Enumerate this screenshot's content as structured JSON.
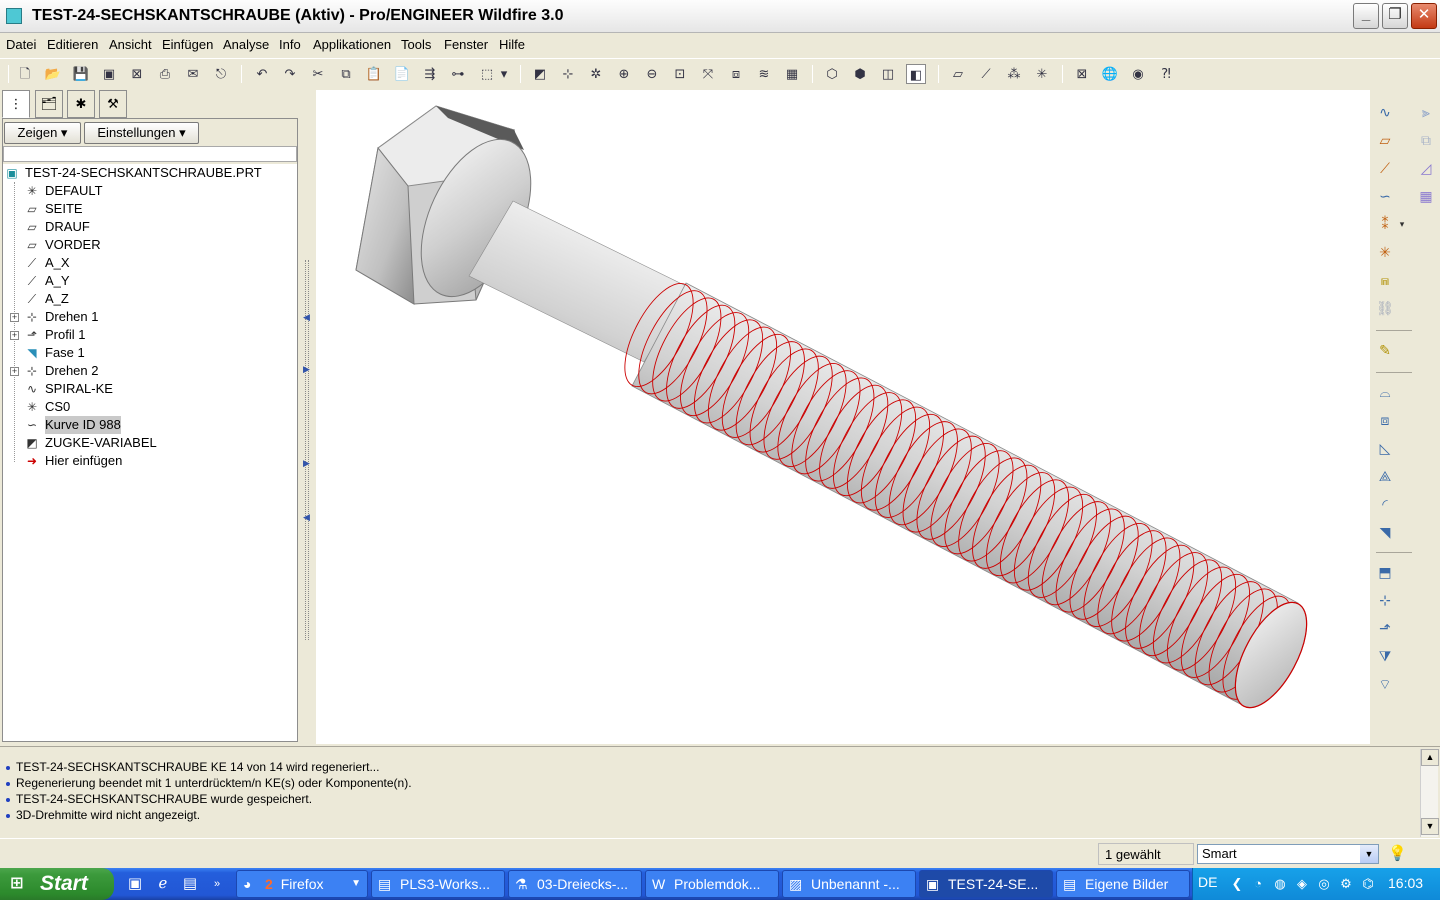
{
  "window": {
    "title": "TEST-24-SECHSKANTSCHRAUBE (Aktiv) - Pro/ENGINEER Wildfire 3.0"
  },
  "menu": [
    "Datei",
    "Editieren",
    "Ansicht",
    "Einfügen",
    "Analyse",
    "Info",
    "Applikationen",
    "Tools",
    "Fenster",
    "Hilfe"
  ],
  "nav": {
    "show_button": "Zeigen",
    "settings_button": "Einstellungen",
    "tree": [
      {
        "label": "TEST-24-SECHSKANTSCHRAUBE.PRT",
        "icon": "part-icon"
      },
      {
        "label": "DEFAULT",
        "icon": "coordinate-system-icon"
      },
      {
        "label": "SEITE",
        "icon": "datum-plane-icon"
      },
      {
        "label": "DRAUF",
        "icon": "datum-plane-icon"
      },
      {
        "label": "VORDER",
        "icon": "datum-plane-icon"
      },
      {
        "label": "A_X",
        "icon": "datum-axis-icon"
      },
      {
        "label": "A_Y",
        "icon": "datum-axis-icon"
      },
      {
        "label": "A_Z",
        "icon": "datum-axis-icon"
      },
      {
        "label": "Drehen 1",
        "icon": "revolve-icon",
        "expandable": true
      },
      {
        "label": "Profil 1",
        "icon": "sweep-icon",
        "expandable": true
      },
      {
        "label": "Fase 1",
        "icon": "chamfer-icon"
      },
      {
        "label": "Drehen 2",
        "icon": "revolve-icon",
        "expandable": true
      },
      {
        "label": "SPIRAL-KE",
        "icon": "helix-icon"
      },
      {
        "label": "CS0",
        "icon": "coordinate-system-icon"
      },
      {
        "label": "Kurve ID 988",
        "icon": "curve-icon",
        "selected": true
      },
      {
        "label": "ZUGKE-VARIABEL",
        "icon": "variable-sweep-icon"
      },
      {
        "label": "Hier einfügen",
        "icon": "insert-here-arrow-icon"
      }
    ]
  },
  "messages": [
    "TEST-24-SECHSKANTSCHRAUBE KE 14 von 14 wird regeneriert...",
    "Regenerierung beendet mit 1 unterdrücktem/n KE(s) oder Komponente(n).",
    "TEST-24-SECHSKANTSCHRAUBE wurde gespeichert.",
    "3D-Drehmitte wird nicht angezeigt."
  ],
  "status": {
    "selected_count": "1 gewählt",
    "filter_value": "Smart"
  },
  "taskbar": {
    "start_label": "Start",
    "tasks": [
      {
        "label": "Firefox",
        "badge": "2",
        "icon": "firefox-icon"
      },
      {
        "label": "PLS3-Works...",
        "icon": "folder-icon"
      },
      {
        "label": "03-Dreiecks-...",
        "icon": "document-icon"
      },
      {
        "label": "Problemdok...",
        "icon": "word-icon"
      },
      {
        "label": "Unbenannt -...",
        "icon": "paint-icon"
      },
      {
        "label": "TEST-24-SE...",
        "icon": "proe-icon",
        "active": true
      },
      {
        "label": "Eigene Bilder",
        "icon": "folder-icon"
      }
    ],
    "language": "DE",
    "clock": "16:03"
  },
  "colors": {
    "thread_lines": "#cc0000",
    "viewport_bg": "#ffffff",
    "taskbar_blue": "#245edc",
    "start_green": "#3c9a3c"
  }
}
